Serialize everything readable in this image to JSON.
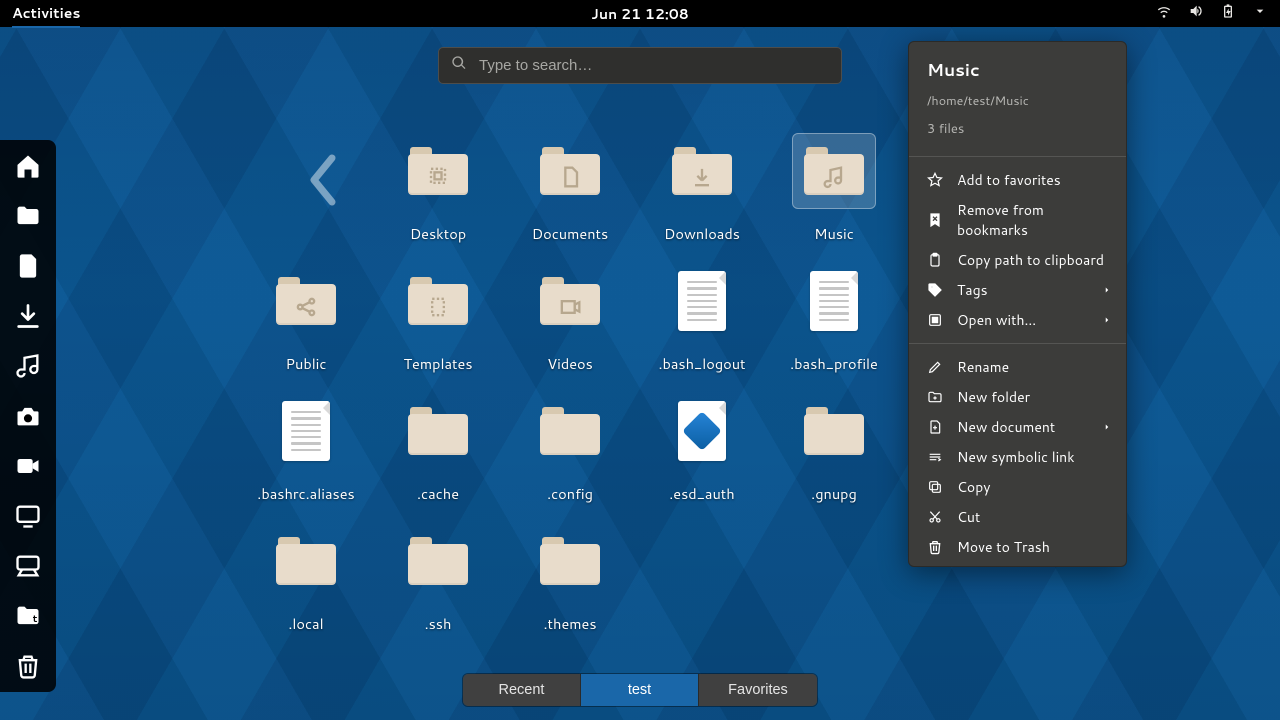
{
  "top_panel": {
    "activities": "Activities",
    "datetime": "Jun 21  12:08",
    "icons": [
      "wifi-icon",
      "volume-icon",
      "battery-icon",
      "caret-down-icon"
    ]
  },
  "search": {
    "placeholder": "Type to search…"
  },
  "dash": {
    "items": [
      {
        "icon": "home-icon",
        "name": "dash-home"
      },
      {
        "icon": "folder-icon",
        "name": "dash-files"
      },
      {
        "icon": "document-icon",
        "name": "dash-documents"
      },
      {
        "icon": "download-icon",
        "name": "dash-downloads"
      },
      {
        "icon": "music-icon",
        "name": "dash-music"
      },
      {
        "icon": "camera-icon",
        "name": "dash-pictures"
      },
      {
        "icon": "video-icon",
        "name": "dash-videos"
      },
      {
        "icon": "monitor-icon",
        "name": "dash-computer"
      },
      {
        "icon": "network-icon",
        "name": "dash-network"
      },
      {
        "icon": "templates-icon",
        "name": "dash-templates"
      },
      {
        "icon": "trash-icon",
        "name": "dash-trash"
      }
    ]
  },
  "grid": {
    "selected_index": 3,
    "items": [
      {
        "label": "Desktop",
        "type": "folder",
        "emblem": "desktop"
      },
      {
        "label": "Documents",
        "type": "folder",
        "emblem": "document"
      },
      {
        "label": "Downloads",
        "type": "folder",
        "emblem": "download"
      },
      {
        "label": "Music",
        "type": "folder",
        "emblem": "music"
      },
      {
        "label": "Public",
        "type": "folder",
        "emblem": "share"
      },
      {
        "label": "Templates",
        "type": "folder",
        "emblem": "template"
      },
      {
        "label": "Videos",
        "type": "folder",
        "emblem": "video"
      },
      {
        "label": ".bash_logout",
        "type": "file-text"
      },
      {
        "label": ".bash_profile",
        "type": "file-text"
      },
      {
        "label": ".bashrc.aliases",
        "type": "file-text"
      },
      {
        "label": ".cache",
        "type": "folder"
      },
      {
        "label": ".config",
        "type": "folder"
      },
      {
        "label": ".esd_auth",
        "type": "file-gem"
      },
      {
        "label": ".gnupg",
        "type": "folder"
      },
      {
        "label": ".local",
        "type": "folder"
      },
      {
        "label": ".ssh",
        "type": "folder"
      },
      {
        "label": ".themes",
        "type": "folder"
      }
    ]
  },
  "switcher": {
    "tabs": [
      {
        "label": "Recent",
        "active": false
      },
      {
        "label": "test",
        "active": true
      },
      {
        "label": "Favorites",
        "active": false
      }
    ]
  },
  "context_menu": {
    "title": "Music",
    "path": "/home/test/Music",
    "count": "3 files",
    "group1": [
      {
        "label": "Add to favorites",
        "icon": "star-icon",
        "submenu": false
      },
      {
        "label": "Remove from bookmarks",
        "icon": "bookmark-x-icon",
        "submenu": false
      },
      {
        "label": "Copy path to clipboard",
        "icon": "clipboard-icon",
        "submenu": false
      },
      {
        "label": "Tags",
        "icon": "tag-icon",
        "submenu": true
      },
      {
        "label": "Open with…",
        "icon": "open-with-icon",
        "submenu": true
      }
    ],
    "group2": [
      {
        "label": "Rename",
        "icon": "pencil-icon",
        "submenu": false
      },
      {
        "label": "New folder",
        "icon": "newfolder-icon",
        "submenu": false
      },
      {
        "label": "New document",
        "icon": "newdoc-icon",
        "submenu": true
      },
      {
        "label": "New symbolic link",
        "icon": "symlink-icon",
        "submenu": false
      },
      {
        "label": "Copy",
        "icon": "copy-icon",
        "submenu": false
      },
      {
        "label": "Cut",
        "icon": "cut-icon",
        "submenu": false
      },
      {
        "label": "Move to Trash",
        "icon": "trash-icon",
        "submenu": false
      }
    ]
  }
}
